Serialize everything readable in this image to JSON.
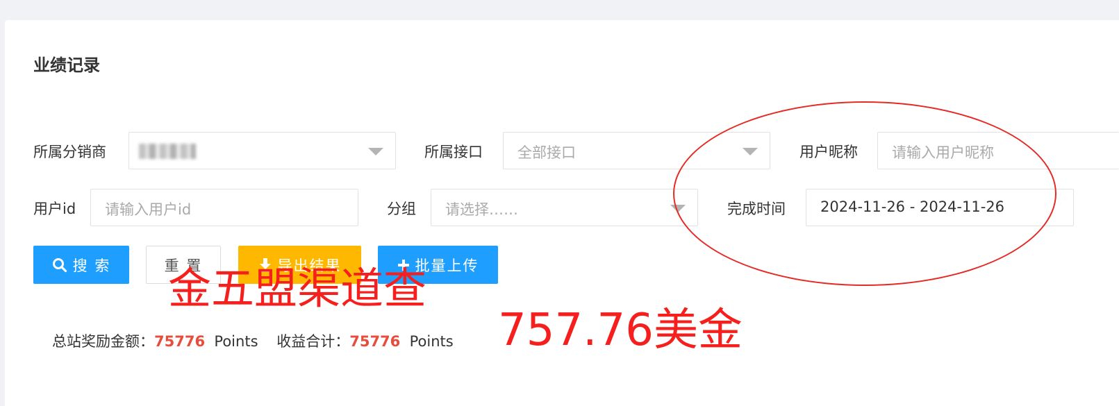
{
  "page": {
    "title": "业绩记录"
  },
  "filters": {
    "distributor": {
      "label": "所属分销商",
      "value": ""
    },
    "interface": {
      "label": "所属接口",
      "placeholder": "全部接口"
    },
    "nickname": {
      "label": "用户昵称",
      "placeholder": "请输入用户昵称"
    },
    "user_id": {
      "label": "用户id",
      "placeholder": "请输入用户id"
    },
    "group": {
      "label": "分组",
      "placeholder": "请选择……"
    },
    "completion_time": {
      "label": "完成时间",
      "value": "2024-11-26 - 2024-11-26"
    }
  },
  "buttons": {
    "search": "搜 索",
    "reset": "重 置",
    "export": "导出结果",
    "batch_upload": "批量上传"
  },
  "stats": {
    "total_reward_label": "总站奖励金额：",
    "total_reward_value": "75776",
    "total_reward_unit": "Points",
    "income_total_label": "收益合计：",
    "income_total_value": "75776",
    "income_total_unit": "Points"
  },
  "annotations": {
    "channel_note": "金五盟渠道查",
    "usd_amount": "757.76美金"
  },
  "icons": {
    "search": "search-icon",
    "download": "download-icon",
    "plus": "plus-icon",
    "caret": "caret-down-icon"
  },
  "colors": {
    "primary": "#1e9fff",
    "warning": "#ffb800",
    "highlight": "#e74c3c",
    "annotation": "#f5201d"
  }
}
